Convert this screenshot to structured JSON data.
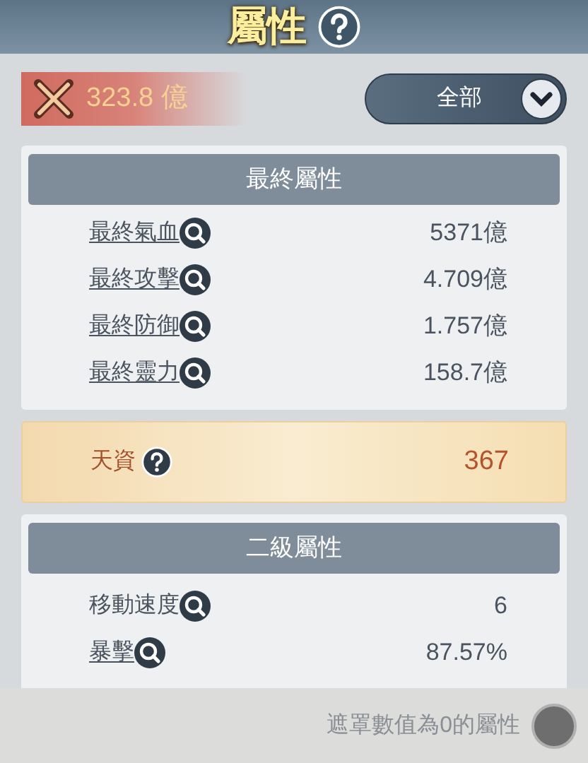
{
  "header": {
    "title": "屬性"
  },
  "power": {
    "value": "323.8 億"
  },
  "filter": {
    "value": "全部"
  },
  "final_section": {
    "title": "最終屬性",
    "rows": [
      {
        "label": "最終氣血",
        "value": "5371億",
        "underlined": true
      },
      {
        "label": "最終攻擊",
        "value": "4.709億",
        "underlined": true
      },
      {
        "label": "最終防御",
        "value": "1.757億",
        "underlined": true
      },
      {
        "label": "最終靈力",
        "value": "158.7億",
        "underlined": true
      }
    ]
  },
  "talent": {
    "label": "天資",
    "value": "367"
  },
  "secondary_section": {
    "title": "二級屬性",
    "rows": [
      {
        "label": "移動速度",
        "value": "6",
        "underlined": false
      },
      {
        "label": "暴擊",
        "value": "87.57%",
        "underlined": true
      }
    ]
  },
  "footer": {
    "toggle_label": "遮罩數值為0的屬性",
    "checked": false
  }
}
